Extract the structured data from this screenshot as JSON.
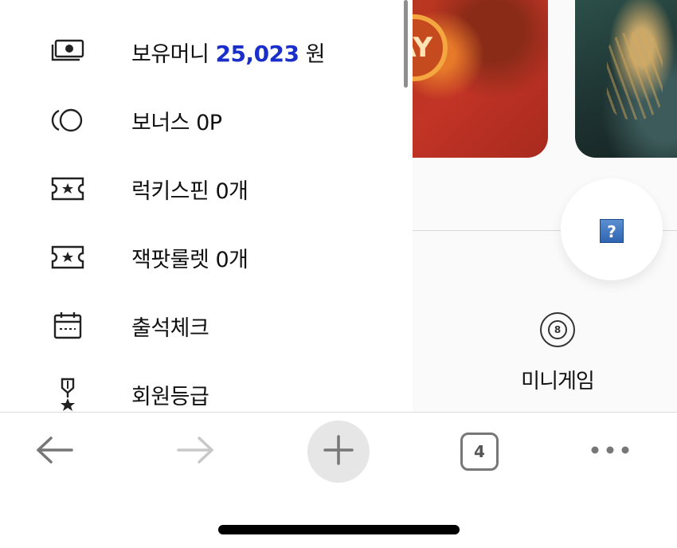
{
  "menu": {
    "items": [
      {
        "icon": "money-icon",
        "label": "보유머니",
        "amount": "25,023",
        "unit": "원"
      },
      {
        "icon": "bonus-coins-icon",
        "label": "보너스 0P"
      },
      {
        "icon": "ticket-star-icon",
        "label": "럭키스핀 0개"
      },
      {
        "icon": "ticket-star-icon",
        "label": "잭팟룰렛 0개"
      },
      {
        "icon": "calendar-icon",
        "label": "출석체크"
      },
      {
        "icon": "medal-icon",
        "label": "회원등급"
      }
    ]
  },
  "background": {
    "banner_text": "AY",
    "help_icon_text": "?",
    "minigame_label": "미니게임",
    "minigame_icon_text": "8"
  },
  "toolbar": {
    "tab_count": "4",
    "icons": [
      "back-arrow-icon",
      "forward-arrow-icon",
      "plus-icon",
      "tabs-icon",
      "more-icon"
    ]
  },
  "colors": {
    "money_accent": "#1a2fc9",
    "help_icon_blue": "#2f64b1"
  }
}
